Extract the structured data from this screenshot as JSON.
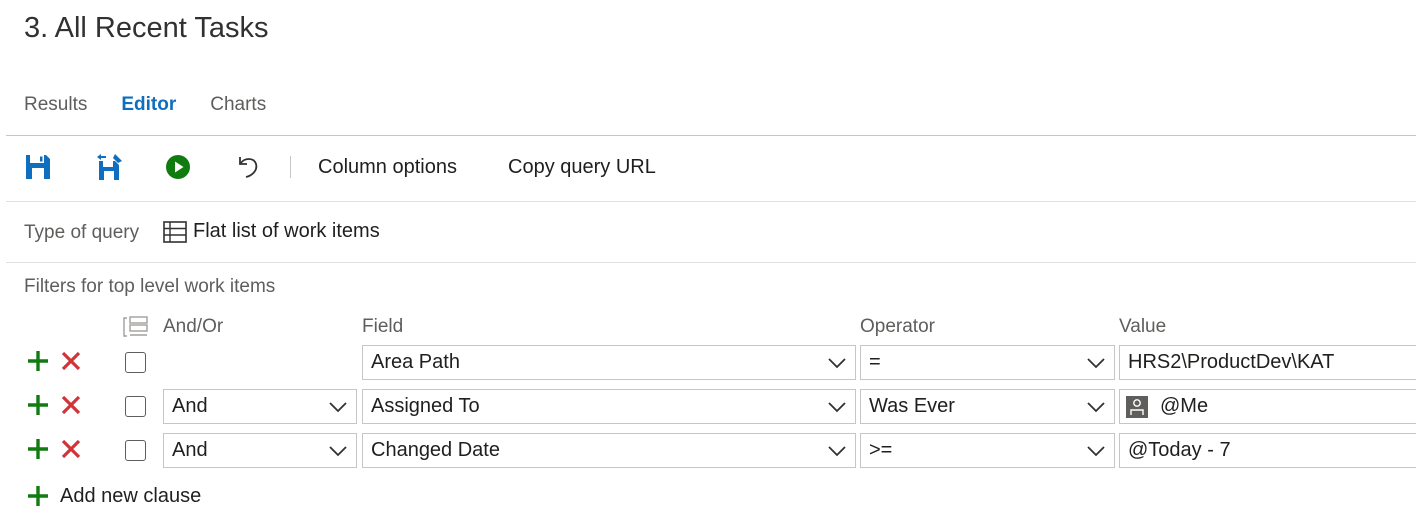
{
  "page": {
    "title": "3. All Recent Tasks"
  },
  "tabs": [
    {
      "label": "Results",
      "active": false
    },
    {
      "label": "Editor",
      "active": true
    },
    {
      "label": "Charts",
      "active": false
    }
  ],
  "toolbar": {
    "icons": [
      "save-icon",
      "save-as-icon",
      "run-query-icon",
      "undo-icon"
    ],
    "column_options": "Column options",
    "copy_url": "Copy query URL"
  },
  "query_type": {
    "label": "Type of query",
    "value": "Flat list of work items",
    "icon": "flat-list-icon"
  },
  "filters": {
    "label": "Filters for top level work items",
    "headers": {
      "and_or": "And/Or",
      "field": "Field",
      "operator": "Operator",
      "value": "Value"
    },
    "rows": [
      {
        "and_or": "",
        "field": "Area Path",
        "operator": "=",
        "value": "HRS2\\ProductDev\\KAT"
      },
      {
        "and_or": "And",
        "field": "Assigned To",
        "operator": "Was Ever",
        "value": "@Me"
      },
      {
        "and_or": "And",
        "field": "Changed Date",
        "operator": ">=",
        "value": "@Today - 7"
      }
    ],
    "add_clause": "Add new clause"
  },
  "colors": {
    "accent": "#106ebe",
    "add": "#107c10",
    "remove": "#d13438"
  }
}
